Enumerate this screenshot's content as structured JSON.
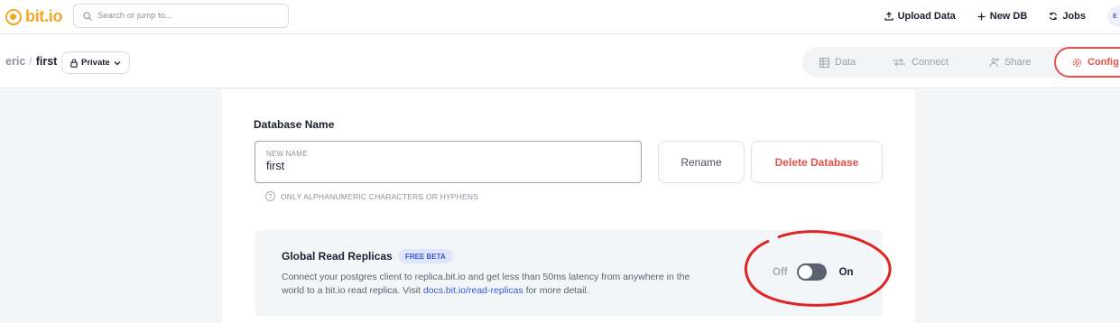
{
  "app": {
    "logo_text": "bit.io",
    "brand_color": "#f5a623"
  },
  "search": {
    "placeholder": "Search or jump to..."
  },
  "top_actions": [
    {
      "label": "Upload Data",
      "icon": "upload-icon"
    },
    {
      "label": "New DB",
      "icon": "plus-icon"
    },
    {
      "label": "Jobs",
      "icon": "refresh-icon"
    }
  ],
  "user": {
    "avatar_initial": "E"
  },
  "breadcrumb": {
    "owner": "eric",
    "separator": "/",
    "database": "first"
  },
  "privacy": {
    "label": "Private",
    "icon": "lock-icon"
  },
  "tabs": [
    {
      "label": "Data",
      "icon": "table-icon",
      "active": false
    },
    {
      "label": "Connect",
      "icon": "connect-arrows-icon",
      "active": false
    },
    {
      "label": "Share",
      "icon": "share-person-icon",
      "active": false
    },
    {
      "label": "Config",
      "icon": "gear-icon",
      "active": true
    }
  ],
  "accent_color": "#e5534b",
  "database_name": {
    "section_title": "Database Name",
    "field_label": "NEW NAME",
    "field_value": "first",
    "hint": "ONLY ALPHANUMERIC CHARACTERS OR HYPHENS",
    "rename_label": "Rename",
    "delete_label": "Delete Database"
  },
  "read_replicas": {
    "title": "Global Read Replicas",
    "badge": "FREE BETA",
    "description_before": "Connect your postgres client to replica.bit.io and get less than 50ms latency from anywhere in the world to a bit.io read replica. Visit ",
    "link_text": "docs.bit.io/read-replicas",
    "description_after": " for more detail.",
    "toggle_off_label": "Off",
    "toggle_on_label": "On",
    "toggle_state": "off"
  }
}
